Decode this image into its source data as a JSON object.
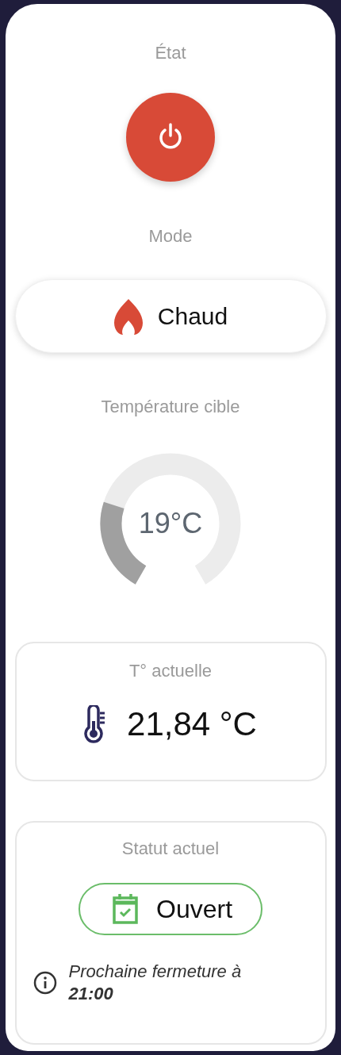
{
  "state": {
    "label": "État",
    "on": true
  },
  "mode": {
    "label": "Mode",
    "value": "Chaud",
    "kind": "heat"
  },
  "target": {
    "label": "Température cible",
    "value": "19°C"
  },
  "current": {
    "label": "T° actuelle",
    "value": "21,84 °C"
  },
  "status": {
    "label": "Statut actuel",
    "value": "Ouvert",
    "open": true,
    "note": "Prochaine fermeture à **21:00**"
  }
}
